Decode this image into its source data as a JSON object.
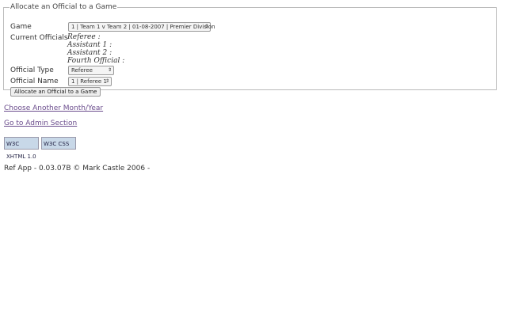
{
  "form": {
    "legend": "Allocate an Official to a Game",
    "game_label": "Game",
    "game_value": "1 | Team 1 v Team 2 | 01-08-2007 | Premier Division",
    "current_label": "Current Officials",
    "officials": [
      "Referee :",
      "Assistant 1 :",
      "Assistant 2 :",
      "Fourth Official :"
    ],
    "type_label": "Official Type",
    "type_value": "Referee",
    "name_label": "Official Name",
    "name_value": "1 | Referee 1",
    "submit": "Allocate an Official to a Game"
  },
  "links": {
    "choose": "Choose Another Month/Year",
    "admin": "Go to Admin Section"
  },
  "badges": {
    "xhtml": "W3C XHTML 1.0",
    "css": "W3C CSS"
  },
  "footer": "Ref App - 0.03.07B © Mark Castle 2006 -"
}
